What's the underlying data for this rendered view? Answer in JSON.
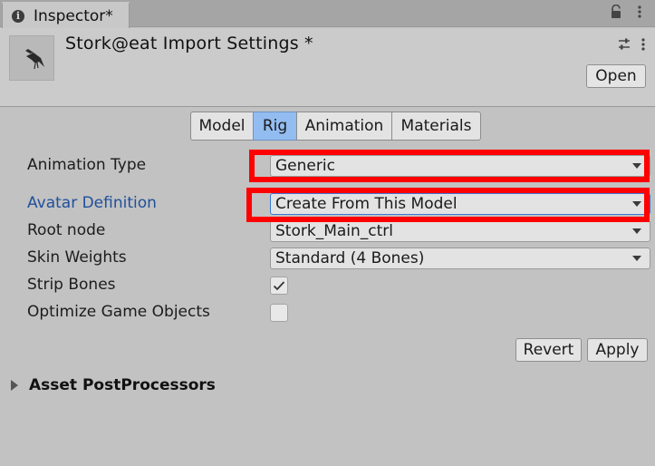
{
  "window": {
    "tab_title": "Inspector*",
    "icons": [
      "info-icon",
      "lock-icon",
      "menu-dots-icon"
    ]
  },
  "header": {
    "title": "Stork@eat Import Settings *",
    "open_label": "Open",
    "icons": [
      "preset-sliders-icon",
      "more-vertical-icon"
    ]
  },
  "tabs": [
    {
      "label": "Model",
      "active": false
    },
    {
      "label": "Rig",
      "active": true
    },
    {
      "label": "Animation",
      "active": false
    },
    {
      "label": "Materials",
      "active": false
    }
  ],
  "rig": {
    "animation_type": {
      "label": "Animation Type",
      "value": "Generic"
    },
    "avatar_definition": {
      "label": "Avatar Definition",
      "value": "Create From This Model"
    },
    "root_node": {
      "label": "Root node",
      "value": "Stork_Main_ctrl"
    },
    "skin_weights": {
      "label": "Skin Weights",
      "value": "Standard (4 Bones)"
    },
    "strip_bones": {
      "label": "Strip Bones",
      "checked": true
    },
    "optimize_game_objects": {
      "label": "Optimize Game Objects",
      "checked": false
    }
  },
  "actions": {
    "revert_label": "Revert",
    "apply_label": "Apply"
  },
  "foldout": {
    "label": "Asset PostProcessors",
    "expanded": false
  },
  "colors": {
    "active_tab": "#93bcf0",
    "avatar_label": "#1f4f9b",
    "highlight": "#ff0000",
    "background": "#c2c2c2"
  }
}
